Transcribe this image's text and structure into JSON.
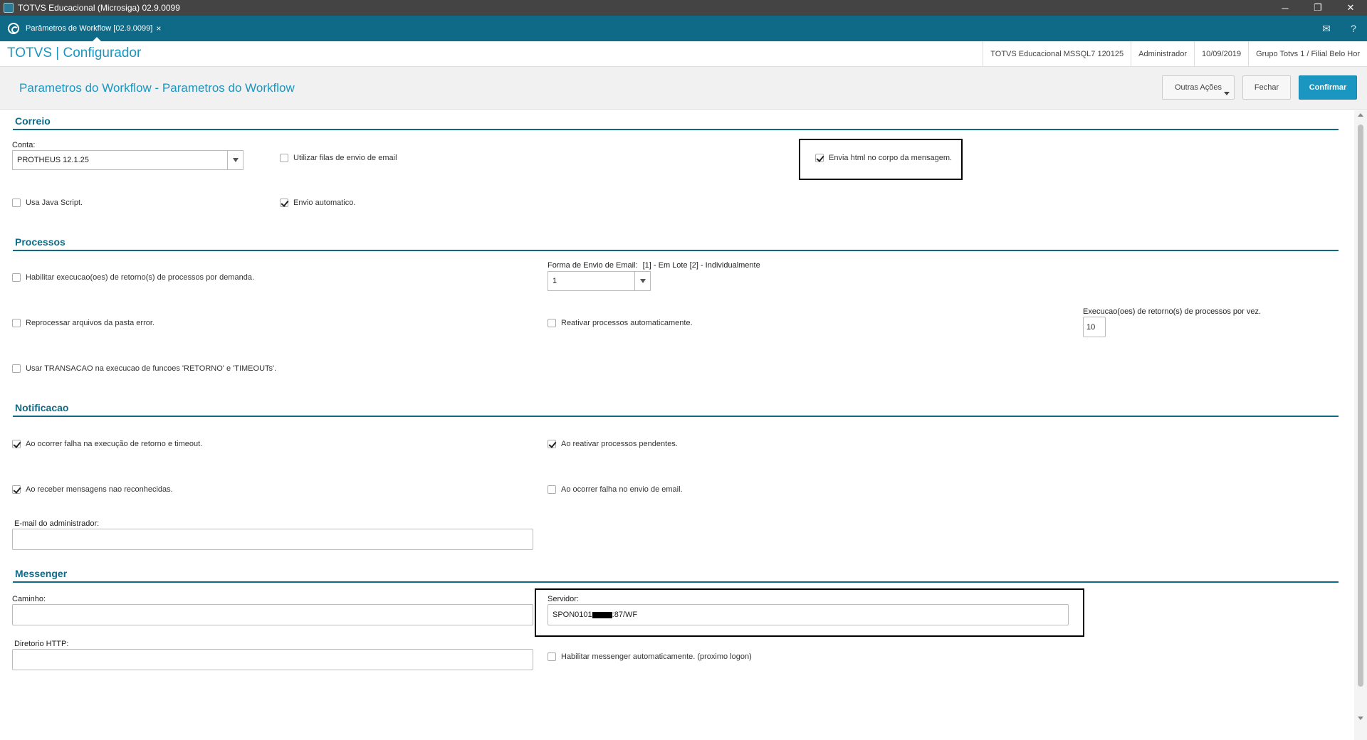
{
  "window": {
    "title": "TOTVS Educacional (Microsiga) 02.9.0099",
    "minimize_glyph": "─",
    "restore_glyph": "❐",
    "close_glyph": "✕"
  },
  "tabbar": {
    "tab_label": "Parâmetros de Workflow [02.9.0099]",
    "tab_close_glyph": "×",
    "mail_icon_glyph": "✉",
    "help_icon_glyph": "?"
  },
  "header": {
    "brand": "TOTVS | Configurador",
    "environment": "TOTVS Educacional MSSQL7 120125",
    "user": "Administrador",
    "date": "10/09/2019",
    "branch": "Grupo Totvs 1 / Filial Belo Hor"
  },
  "page": {
    "title": "Parametros do Workflow - Parametros do Workflow",
    "btn_outras": "Outras Ações",
    "btn_fechar": "Fechar",
    "btn_confirmar": "Confirmar"
  },
  "correio": {
    "title": "Correio",
    "conta_label": "Conta:",
    "conta_value": "PROTHEUS 12.1.25",
    "filas_label": "Utilizar filas de envio de email",
    "envia_html_label": "Envia html no corpo da mensagem.",
    "java_label": "Usa Java Script.",
    "envio_auto_label": "Envio automatico."
  },
  "processos": {
    "title": "Processos",
    "habilitar_label": "Habilitar execucao(oes) de retorno(s) de processos por demanda.",
    "forma_label": "Forma de Envio de Email:",
    "forma_hint": "[1] - Em Lote [2] - Individualmente",
    "forma_value": "1",
    "reprocessar_label": "Reprocessar arquivos da pasta error.",
    "reativar_label": "Reativar processos automaticamente.",
    "execucoes_label": "Execucao(oes) de retorno(s) de processos por vez.",
    "execucoes_value": "10",
    "transacao_label": "Usar TRANSACAO na execucao de funcoes 'RETORNO' e 'TIMEOUTs'."
  },
  "notificacao": {
    "title": "Notificacao",
    "falha_retorno_label": "Ao ocorrer falha na execução de retorno e timeout.",
    "reativar_pend_label": "Ao reativar processos pendentes.",
    "receber_label": "Ao receber mensagens nao reconhecidas.",
    "falha_email_label": "Ao ocorrer falha no envio de email.",
    "email_admin_label": "E-mail do administrador:",
    "email_admin_value": ""
  },
  "messenger": {
    "title": "Messenger",
    "caminho_label": "Caminho:",
    "caminho_value": "",
    "servidor_label": "Servidor:",
    "servidor_prefix": "SPON0101",
    "servidor_suffix": ":87/WF",
    "diretorio_label": "Diretorio HTTP:",
    "diretorio_value": "",
    "habilitar_label": "Habilitar messenger automaticamente. (proximo logon)"
  }
}
